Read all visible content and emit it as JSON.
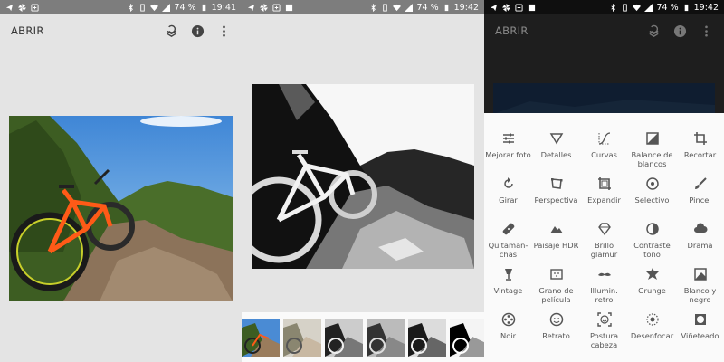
{
  "status": {
    "battery": "74 %",
    "time_1": "19:41",
    "time_2": "19:42",
    "time_3": "19:42"
  },
  "appbar": {
    "title": "ABRIR"
  },
  "tools": [
    {
      "label": "Mejorar foto",
      "icon": "tune-icon"
    },
    {
      "label": "Detalles",
      "icon": "triangle-icon"
    },
    {
      "label": "Curvas",
      "icon": "curves-icon"
    },
    {
      "label": "Balance de blancos",
      "icon": "white-balance-icon"
    },
    {
      "label": "Recortar",
      "icon": "crop-icon"
    },
    {
      "label": "Girar",
      "icon": "rotate-icon"
    },
    {
      "label": "Perspectiva",
      "icon": "perspective-icon"
    },
    {
      "label": "Expandir",
      "icon": "expand-icon"
    },
    {
      "label": "Selectivo",
      "icon": "target-icon"
    },
    {
      "label": "Pincel",
      "icon": "brush-icon"
    },
    {
      "label": "Quitaman-chas",
      "icon": "bandage-icon"
    },
    {
      "label": "Paisaje HDR",
      "icon": "mountain-icon"
    },
    {
      "label": "Brillo glamur",
      "icon": "diamond-icon"
    },
    {
      "label": "Contraste tono",
      "icon": "contrast-icon"
    },
    {
      "label": "Drama",
      "icon": "cloud-icon"
    },
    {
      "label": "Vintage",
      "icon": "lamp-icon"
    },
    {
      "label": "Grano de película",
      "icon": "grain-icon"
    },
    {
      "label": "Illumin. retro",
      "icon": "mustache-icon"
    },
    {
      "label": "Grunge",
      "icon": "grunge-icon"
    },
    {
      "label": "Blanco y negro",
      "icon": "bw-icon"
    },
    {
      "label": "Noir",
      "icon": "film-reel-icon"
    },
    {
      "label": "Retrato",
      "icon": "face-icon"
    },
    {
      "label": "Postura cabeza",
      "icon": "face-frame-icon"
    },
    {
      "label": "Desenfocar",
      "icon": "blur-icon"
    },
    {
      "label": "Viñeteado",
      "icon": "vignette-icon"
    }
  ],
  "colors": {
    "status_bar": "#7d7d7d",
    "app_background": "#e4e4e4",
    "tool_sheet": "#fafafa",
    "dark_overlay": "#1e1e1e"
  }
}
